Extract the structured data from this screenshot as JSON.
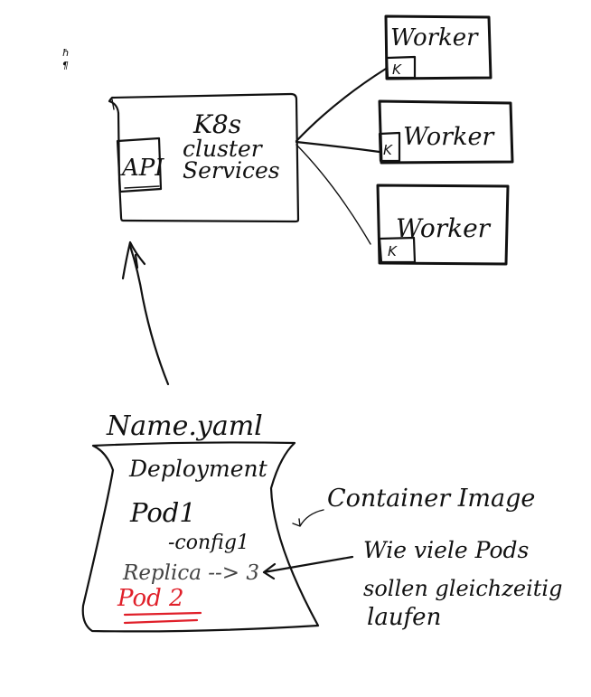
{
  "diagram": {
    "cluster": {
      "title_line1": "K8s",
      "title_line2": "cluster",
      "title_line3": "Services",
      "api_label": "API"
    },
    "workers": [
      {
        "label": "Worker",
        "badge": "K"
      },
      {
        "label": "Worker",
        "badge": "K"
      },
      {
        "label": "Worker",
        "badge": "K"
      }
    ],
    "yaml": {
      "filename": "Name.yaml",
      "line_deployment": "Deployment",
      "line_pod1": "Pod1",
      "line_config": "-config1",
      "line_replica": "Replica --> 3",
      "line_pod2": "Pod 2"
    },
    "annotations": {
      "container_image": "Container Image",
      "pods_line1": "Wie viele Pods",
      "pods_line2": "sollen gleichzeitig",
      "pods_line3": "laufen"
    },
    "margin_marks": {
      "mark1": "ħ",
      "mark2": "¶"
    },
    "colors": {
      "ink": "#111111",
      "highlight": "#e0202a"
    }
  }
}
